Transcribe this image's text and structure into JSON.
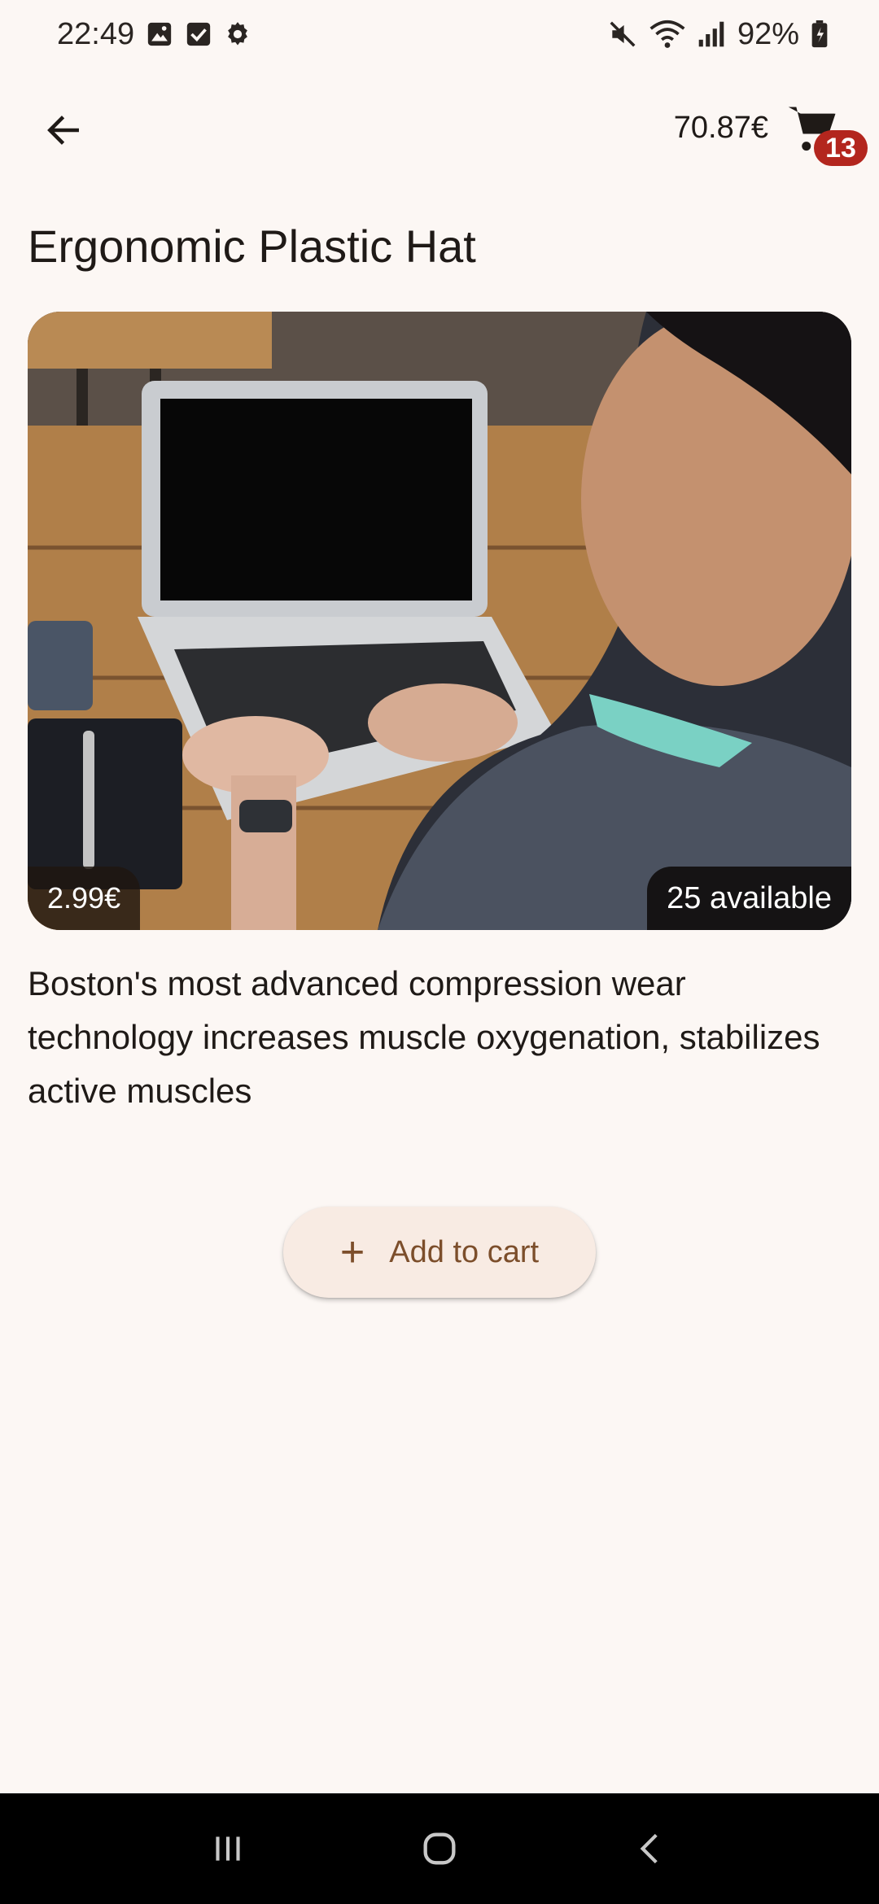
{
  "status_bar": {
    "time": "22:49",
    "battery": "92%",
    "icons_left": [
      "gallery-icon",
      "checkbox-icon",
      "settings-icon"
    ],
    "icons_right": [
      "mute-icon",
      "wifi-icon",
      "signal-icon",
      "battery-icon"
    ]
  },
  "app_bar": {
    "cart_total": "70.87€",
    "cart_count": "13"
  },
  "product": {
    "title": "Ergonomic Plastic Hat",
    "price": "2.99€",
    "availability": "25 available",
    "description": "Boston's most advanced compression wear technology increases muscle oxygenation, stabilizes active muscles",
    "image": "laptop-photo"
  },
  "actions": {
    "add_to_cart": "Add to cart"
  },
  "colors": {
    "background": "#fcf7f4",
    "accent": "#7c4e2b",
    "badge": "#b3261e",
    "button_bg": "#f8ebe3"
  }
}
